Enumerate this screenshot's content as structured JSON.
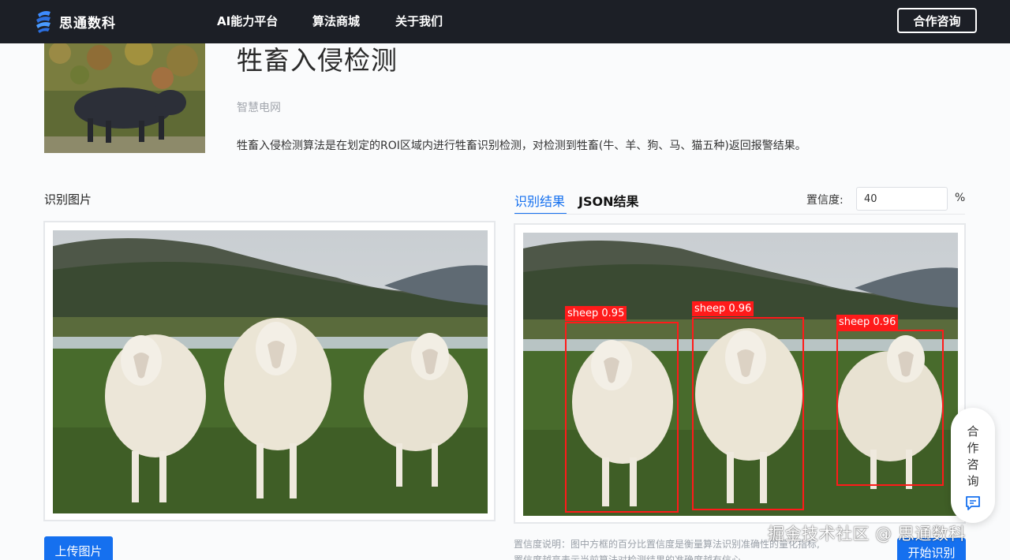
{
  "nav": {
    "brand": "思通数科",
    "items": [
      "AI能力平台",
      "算法商城",
      "关于我们"
    ],
    "cta": "合作咨询"
  },
  "header": {
    "title": "牲畜入侵检测",
    "category": "智慧电网",
    "description": "牲畜入侵检测算法是在划定的ROI区域内进行牲畜识别检测，对检测到牲畜(牛、羊、狗、马、猫五种)返回报警结果。"
  },
  "left": {
    "label": "识别图片",
    "upload_button": "上传图片"
  },
  "right": {
    "tabs": [
      "识别结果",
      "JSON结果"
    ],
    "confidence_label": "置信度:",
    "confidence_value": "40",
    "confidence_unit": "%",
    "detections": [
      {
        "label": "sheep 0.95"
      },
      {
        "label": "sheep 0.96"
      },
      {
        "label": "sheep 0.96"
      }
    ],
    "note_line1": "置信度说明：图中方框的百分比置信度是衡量算法识别准确性的量化指标,",
    "note_line2": "置信度越高表示当前算法对检测结果的准确度越有信心。",
    "start_button": "开始识别"
  },
  "float_consult": {
    "chars": [
      "合",
      "作",
      "咨",
      "询"
    ]
  },
  "watermark": "掘金技术社区 @ 思通数科",
  "colors": {
    "nav_bg": "#1c1f26",
    "primary": "#1570ef",
    "detection": "#ff1a1a"
  }
}
